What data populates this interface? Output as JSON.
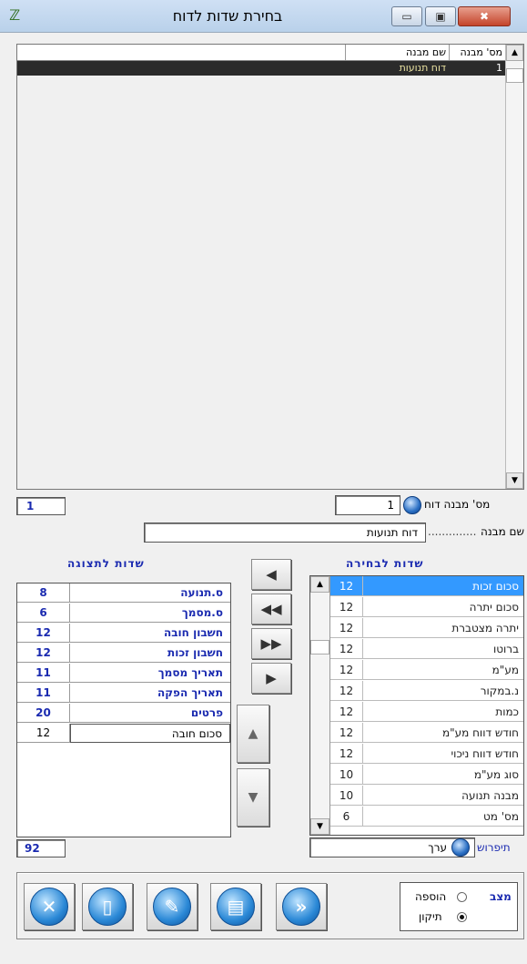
{
  "window": {
    "title": "בחירת שדות לדוח",
    "minimize": "▭",
    "maximize": "▣",
    "close": "✖"
  },
  "grid": {
    "columns": [
      "מס' מבנה",
      "שם מבנה"
    ],
    "rows": [
      {
        "num": "1",
        "name": "דוח תנועות"
      }
    ]
  },
  "left_counter": "1",
  "report_no": {
    "label": "מס' מבנה דוח",
    "value": "1"
  },
  "structure_name": {
    "label": "שם מבנה",
    "value": "דוח תנועות"
  },
  "display_fields": {
    "title": "שדות לתצוגה",
    "rows": [
      {
        "num": "8",
        "name": "ס.תנועה"
      },
      {
        "num": "6",
        "name": "ס.מסמך"
      },
      {
        "num": "12",
        "name": "חשבון חובה"
      },
      {
        "num": "12",
        "name": "חשבון זכות"
      },
      {
        "num": "11",
        "name": "תאריך מסמך"
      },
      {
        "num": "11",
        "name": "תאריך הפקה"
      },
      {
        "num": "20",
        "name": "פרטים"
      }
    ],
    "edit_row": {
      "num": "12",
      "name": "סכום חובה"
    },
    "total": "92"
  },
  "selection_fields": {
    "title": "שדות לבחירה",
    "rows": [
      {
        "num": "12",
        "name": "סכום זכות",
        "selected": true
      },
      {
        "num": "12",
        "name": "סכום יתרה"
      },
      {
        "num": "12",
        "name": "יתרה מצטברת"
      },
      {
        "num": "12",
        "name": "ברוטו"
      },
      {
        "num": "12",
        "name": "מע\"מ"
      },
      {
        "num": "12",
        "name": "נ.במקור"
      },
      {
        "num": "12",
        "name": "כמות"
      },
      {
        "num": "12",
        "name": "חודש דווח מע\"מ"
      },
      {
        "num": "12",
        "name": "חודש דווח ניכוי"
      },
      {
        "num": "10",
        "name": "סוג מע\"מ"
      },
      {
        "num": "10",
        "name": "מבנה תנועה"
      },
      {
        "num": "6",
        "name": "מס' מט"
      }
    ]
  },
  "explanation": {
    "label": "תיפרוש",
    "value": "ערך"
  },
  "mode": {
    "label": "מצב",
    "options": [
      {
        "label": "הוספה",
        "checked": false
      },
      {
        "label": "תיקון",
        "checked": true
      }
    ]
  },
  "move_buttons": [
    "◀",
    "◀◀",
    "▶▶",
    "▶"
  ],
  "order_buttons": [
    "▲",
    "▼"
  ],
  "toolbar_icons": [
    "close-icon",
    "trash-icon",
    "edit-icon",
    "computers-icon",
    "forward-icon"
  ],
  "colors": {
    "accent": "#1a2ab0",
    "selection": "#3399ff",
    "grid_selected_row": "#2b2b2b"
  }
}
